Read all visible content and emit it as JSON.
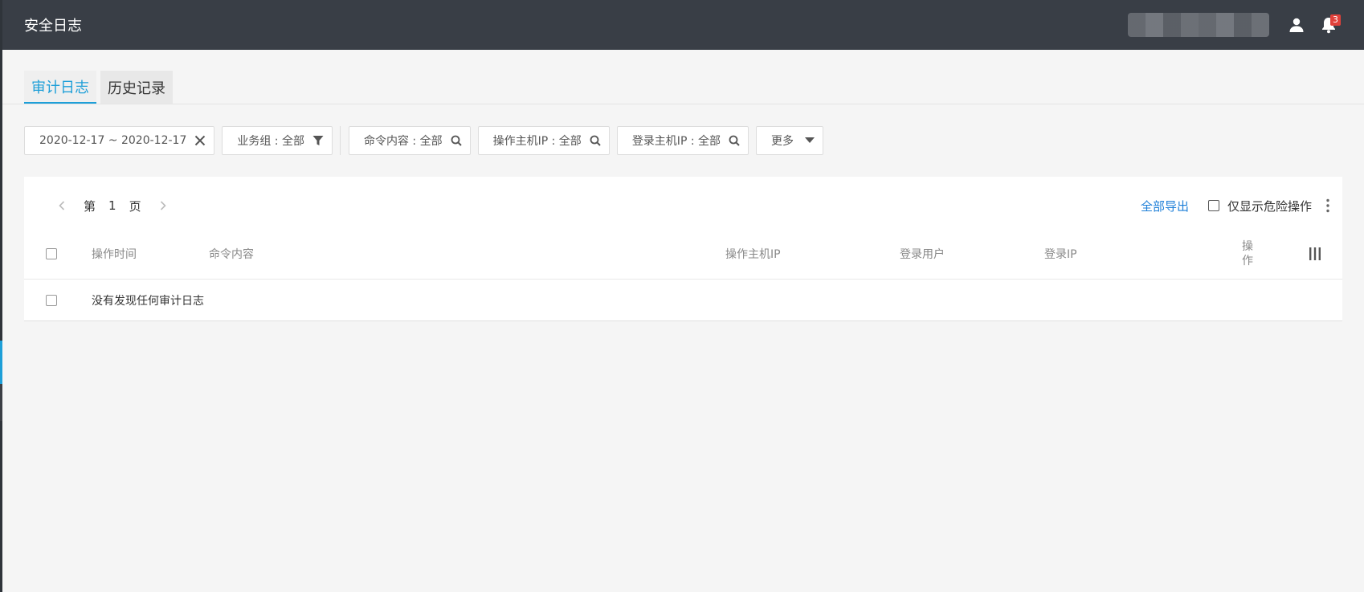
{
  "header": {
    "title": "安全日志",
    "notification_count": "3"
  },
  "tabs": [
    {
      "label": "审计日志",
      "active": true
    },
    {
      "label": "历史记录",
      "active": false
    }
  ],
  "filters": {
    "date_range": "2020-12-17 ~ 2020-12-17",
    "business_group": "业务组 : 全部",
    "command_content": "命令内容 : 全部",
    "operation_host_ip": "操作主机IP : 全部",
    "login_host_ip": "登录主机IP : 全部",
    "more": "更多"
  },
  "pager": {
    "prefix": "第",
    "page": "1",
    "suffix": "页"
  },
  "toolbar": {
    "export_all": "全部导出",
    "only_dangerous": "仅显示危险操作"
  },
  "table": {
    "columns": [
      "操作时间",
      "命令内容",
      "操作主机IP",
      "登录用户",
      "登录IP",
      "操",
      "作"
    ],
    "empty_text": "没有发现任何审计日志"
  },
  "colors": {
    "accent": "#1e9fd8",
    "topbar": "#393e46",
    "link": "#1e7fd8",
    "badge": "#e0403a"
  }
}
